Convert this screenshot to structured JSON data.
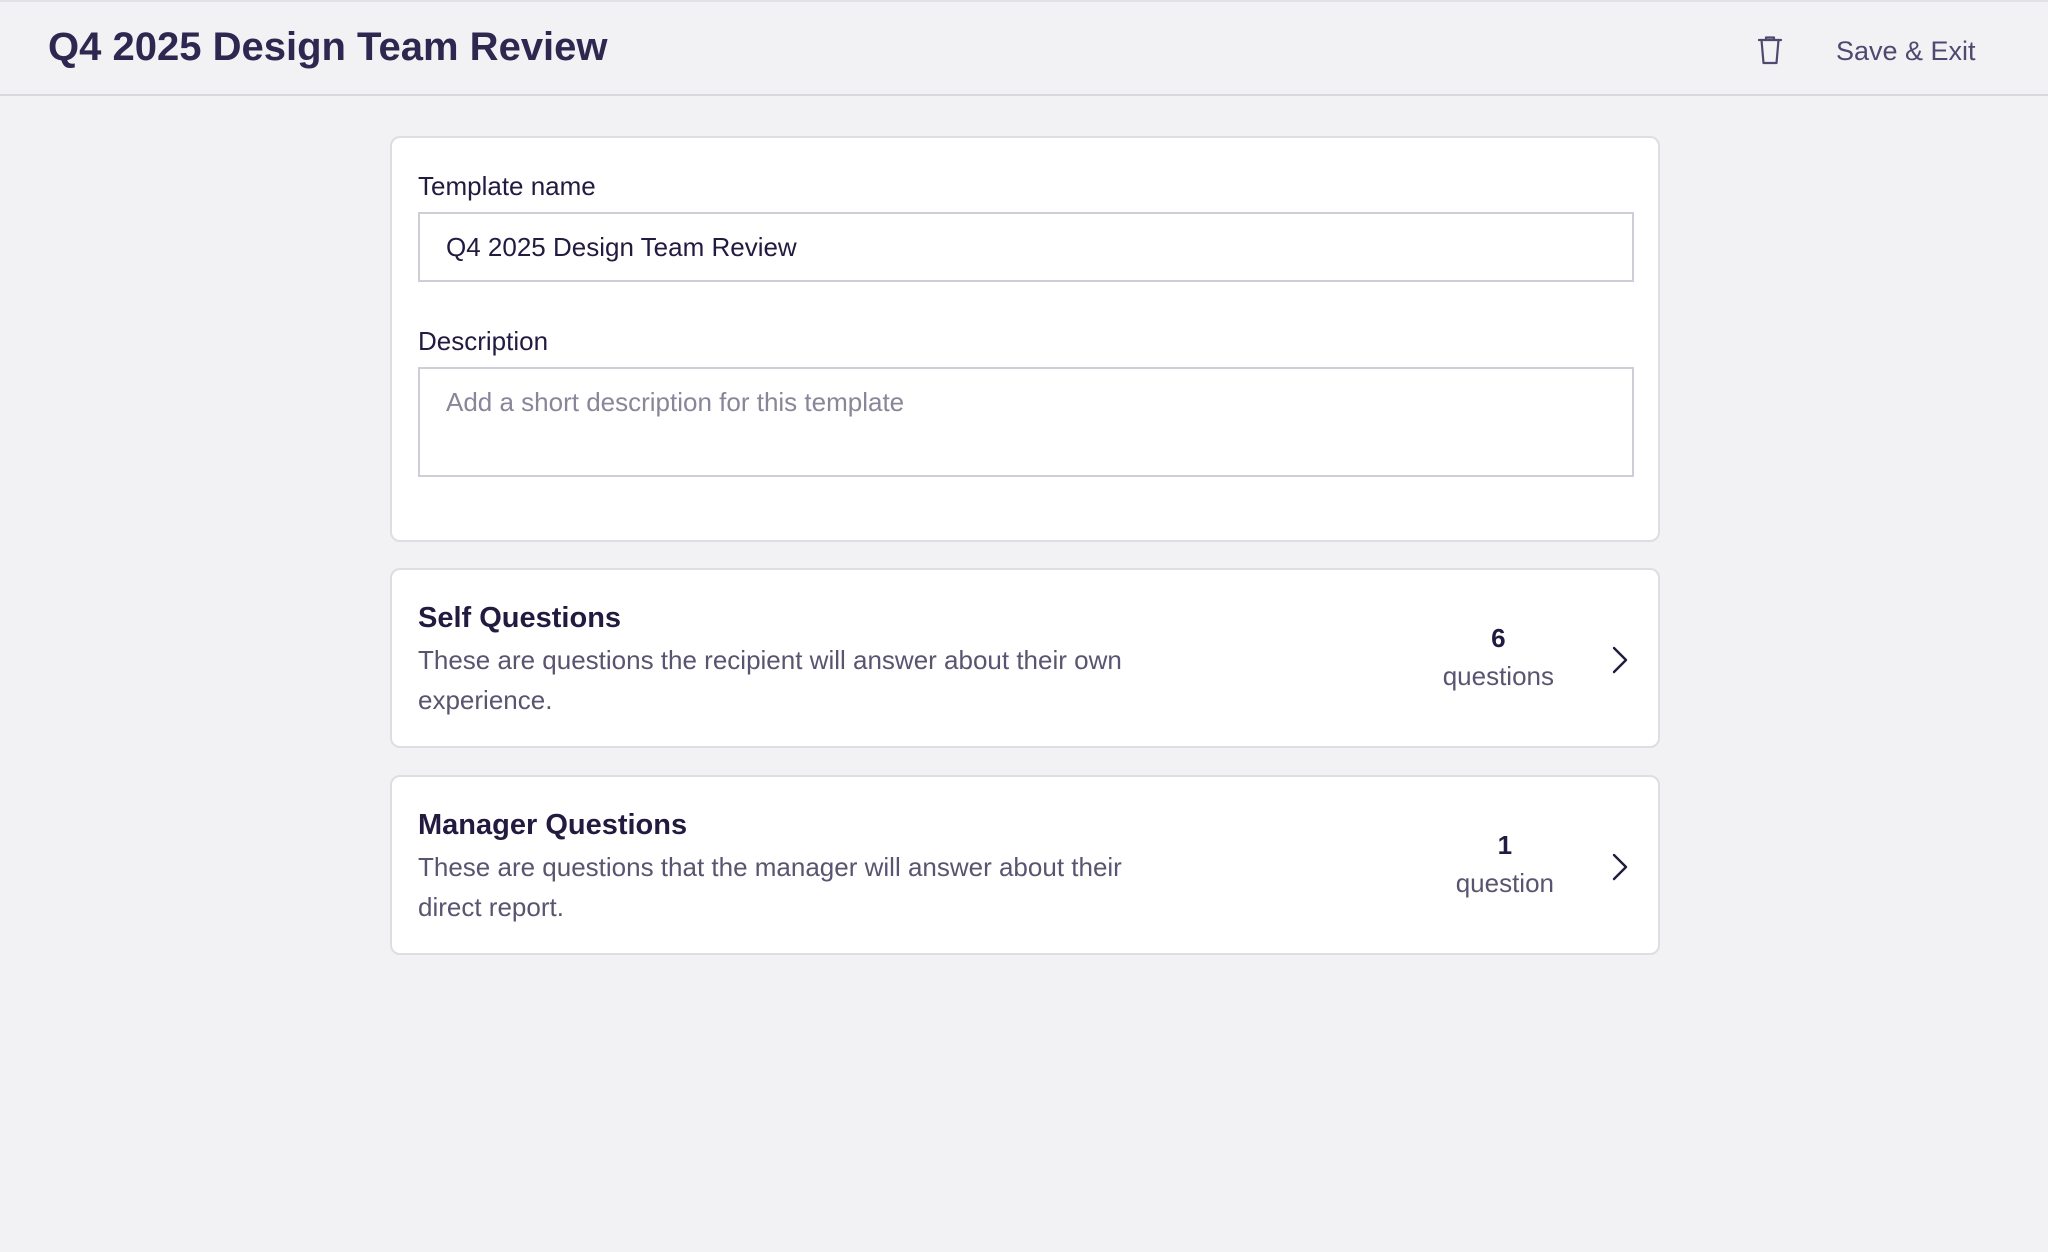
{
  "header": {
    "title": "Q4 2025 Design Team Review",
    "save_exit_label": "Save & Exit",
    "delete_icon": "trash-icon"
  },
  "form": {
    "template_name_label": "Template name",
    "template_name_value": "Q4 2025 Design Team Review",
    "description_label": "Description",
    "description_value": "",
    "description_placeholder": "Add a short description for this template"
  },
  "sections": [
    {
      "title": "Self Questions",
      "description": "These are questions the recipient will answer about their own experience.",
      "count": "6",
      "count_unit": "questions",
      "icon": "chevron-right-icon"
    },
    {
      "title": "Manager Questions",
      "description": "These are questions that the manager will answer about their direct report.",
      "count": "1",
      "count_unit": "question",
      "icon": "chevron-right-icon"
    }
  ],
  "colors": {
    "background": "#f2f2f4",
    "card": "#ffffff",
    "text_primary": "#231a40",
    "text_secondary": "#5a5470"
  }
}
